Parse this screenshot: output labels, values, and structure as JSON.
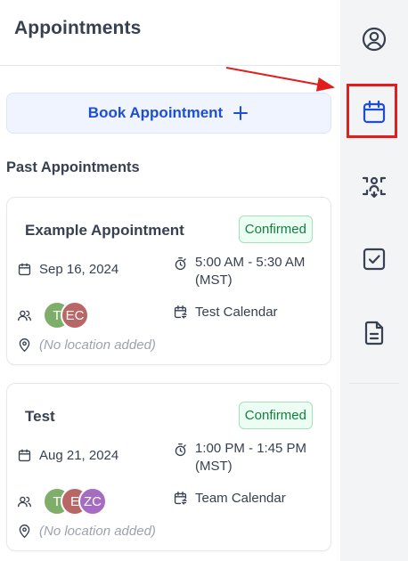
{
  "header": {
    "title": "Appointments"
  },
  "book_button": {
    "label": "Book Appointment"
  },
  "section": {
    "title": "Past Appointments"
  },
  "appointments": [
    {
      "title": "Example Appointment",
      "status": "Confirmed",
      "date": "Sep 16, 2024",
      "time_line1": "5:00 AM - 5:30 AM",
      "time_line2": "(MST)",
      "calendar": "Test Calendar",
      "location": "(No location added)",
      "attendees": [
        "T",
        "EC"
      ]
    },
    {
      "title": "Test",
      "status": "Confirmed",
      "date": "Aug 21, 2024",
      "time_line1": "1:00 PM - 1:45 PM",
      "time_line2": "(MST)",
      "calendar": "Team Calendar",
      "location": "(No location added)",
      "attendees": [
        "T",
        "E",
        "ZC"
      ]
    }
  ],
  "sidebar": {
    "icons": [
      "user-circle-icon",
      "calendar-icon",
      "users-arrows-icon",
      "checkbox-icon",
      "document-icon"
    ],
    "active": "calendar-icon"
  },
  "colors": {
    "accent": "#1d4ed8",
    "status_confirmed": "#15803d",
    "highlight": "#e11d1d"
  }
}
